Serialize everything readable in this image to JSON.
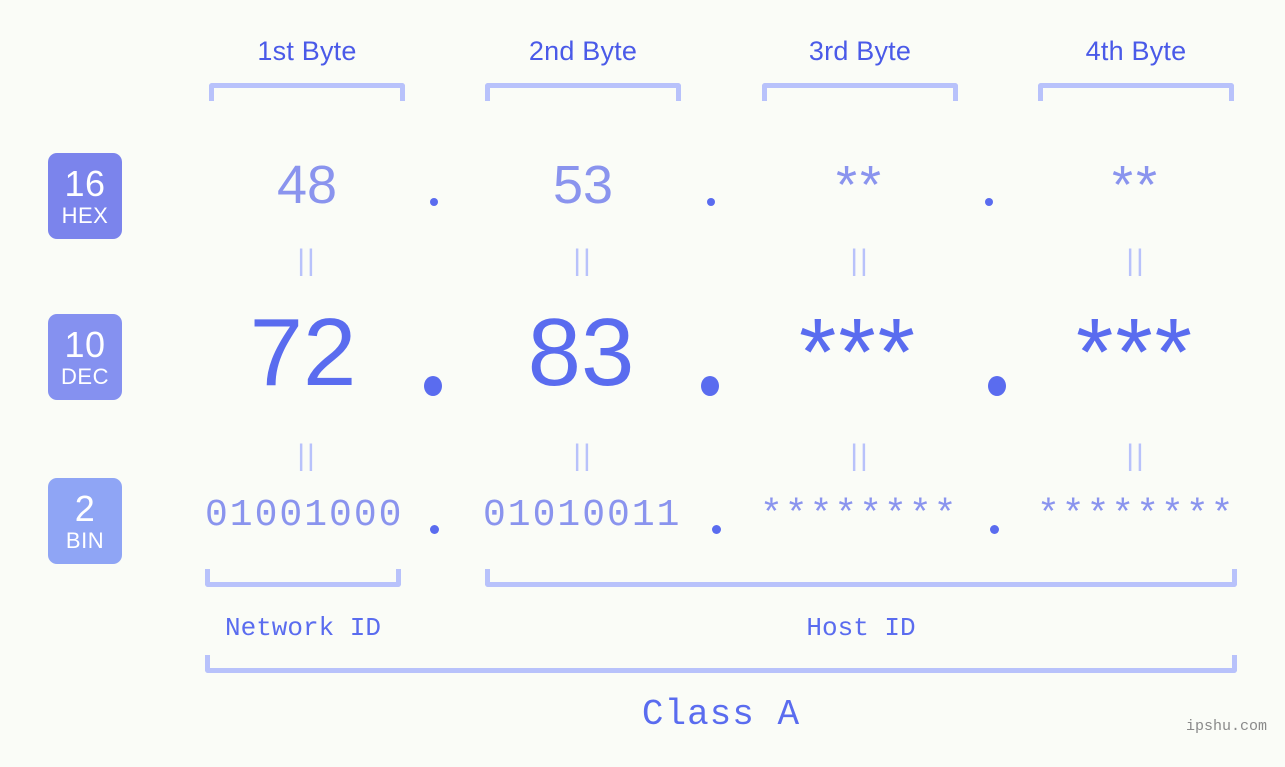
{
  "background_color": "#fafcf7",
  "accent_colors": {
    "header_blue": "#4a5ae8",
    "bracket_blue": "#b8c2fb",
    "hex_blue": "#8a94ee",
    "dec_blue": "#5a6cef",
    "badge_hex": "#7b84ec",
    "badge_dec": "#8591f0",
    "badge_bin": "#8fa5f5",
    "watermark_gray": "#8a8a8a"
  },
  "columns": [
    {
      "header": "1st Byte"
    },
    {
      "header": "2nd Byte"
    },
    {
      "header": "3rd Byte"
    },
    {
      "header": "4th Byte"
    }
  ],
  "bases": [
    {
      "num": "16",
      "abbr": "HEX",
      "color": "#7b84ec"
    },
    {
      "num": "10",
      "abbr": "DEC",
      "color": "#8591f0"
    },
    {
      "num": "2",
      "abbr": "BIN",
      "color": "#8fa5f5"
    }
  ],
  "rows": {
    "hex": {
      "values": [
        "48",
        "53",
        "**",
        "**"
      ]
    },
    "dec": {
      "values": [
        "72",
        "83",
        "***",
        "***"
      ]
    },
    "bin": {
      "values": [
        "01001000",
        "01010011",
        "********",
        "********"
      ]
    }
  },
  "separator": ".",
  "equivalence_mark": "||",
  "regions": [
    {
      "label": "Network ID"
    },
    {
      "label": "Host ID"
    }
  ],
  "class_label": "Class A",
  "watermark": "ipshu.com"
}
